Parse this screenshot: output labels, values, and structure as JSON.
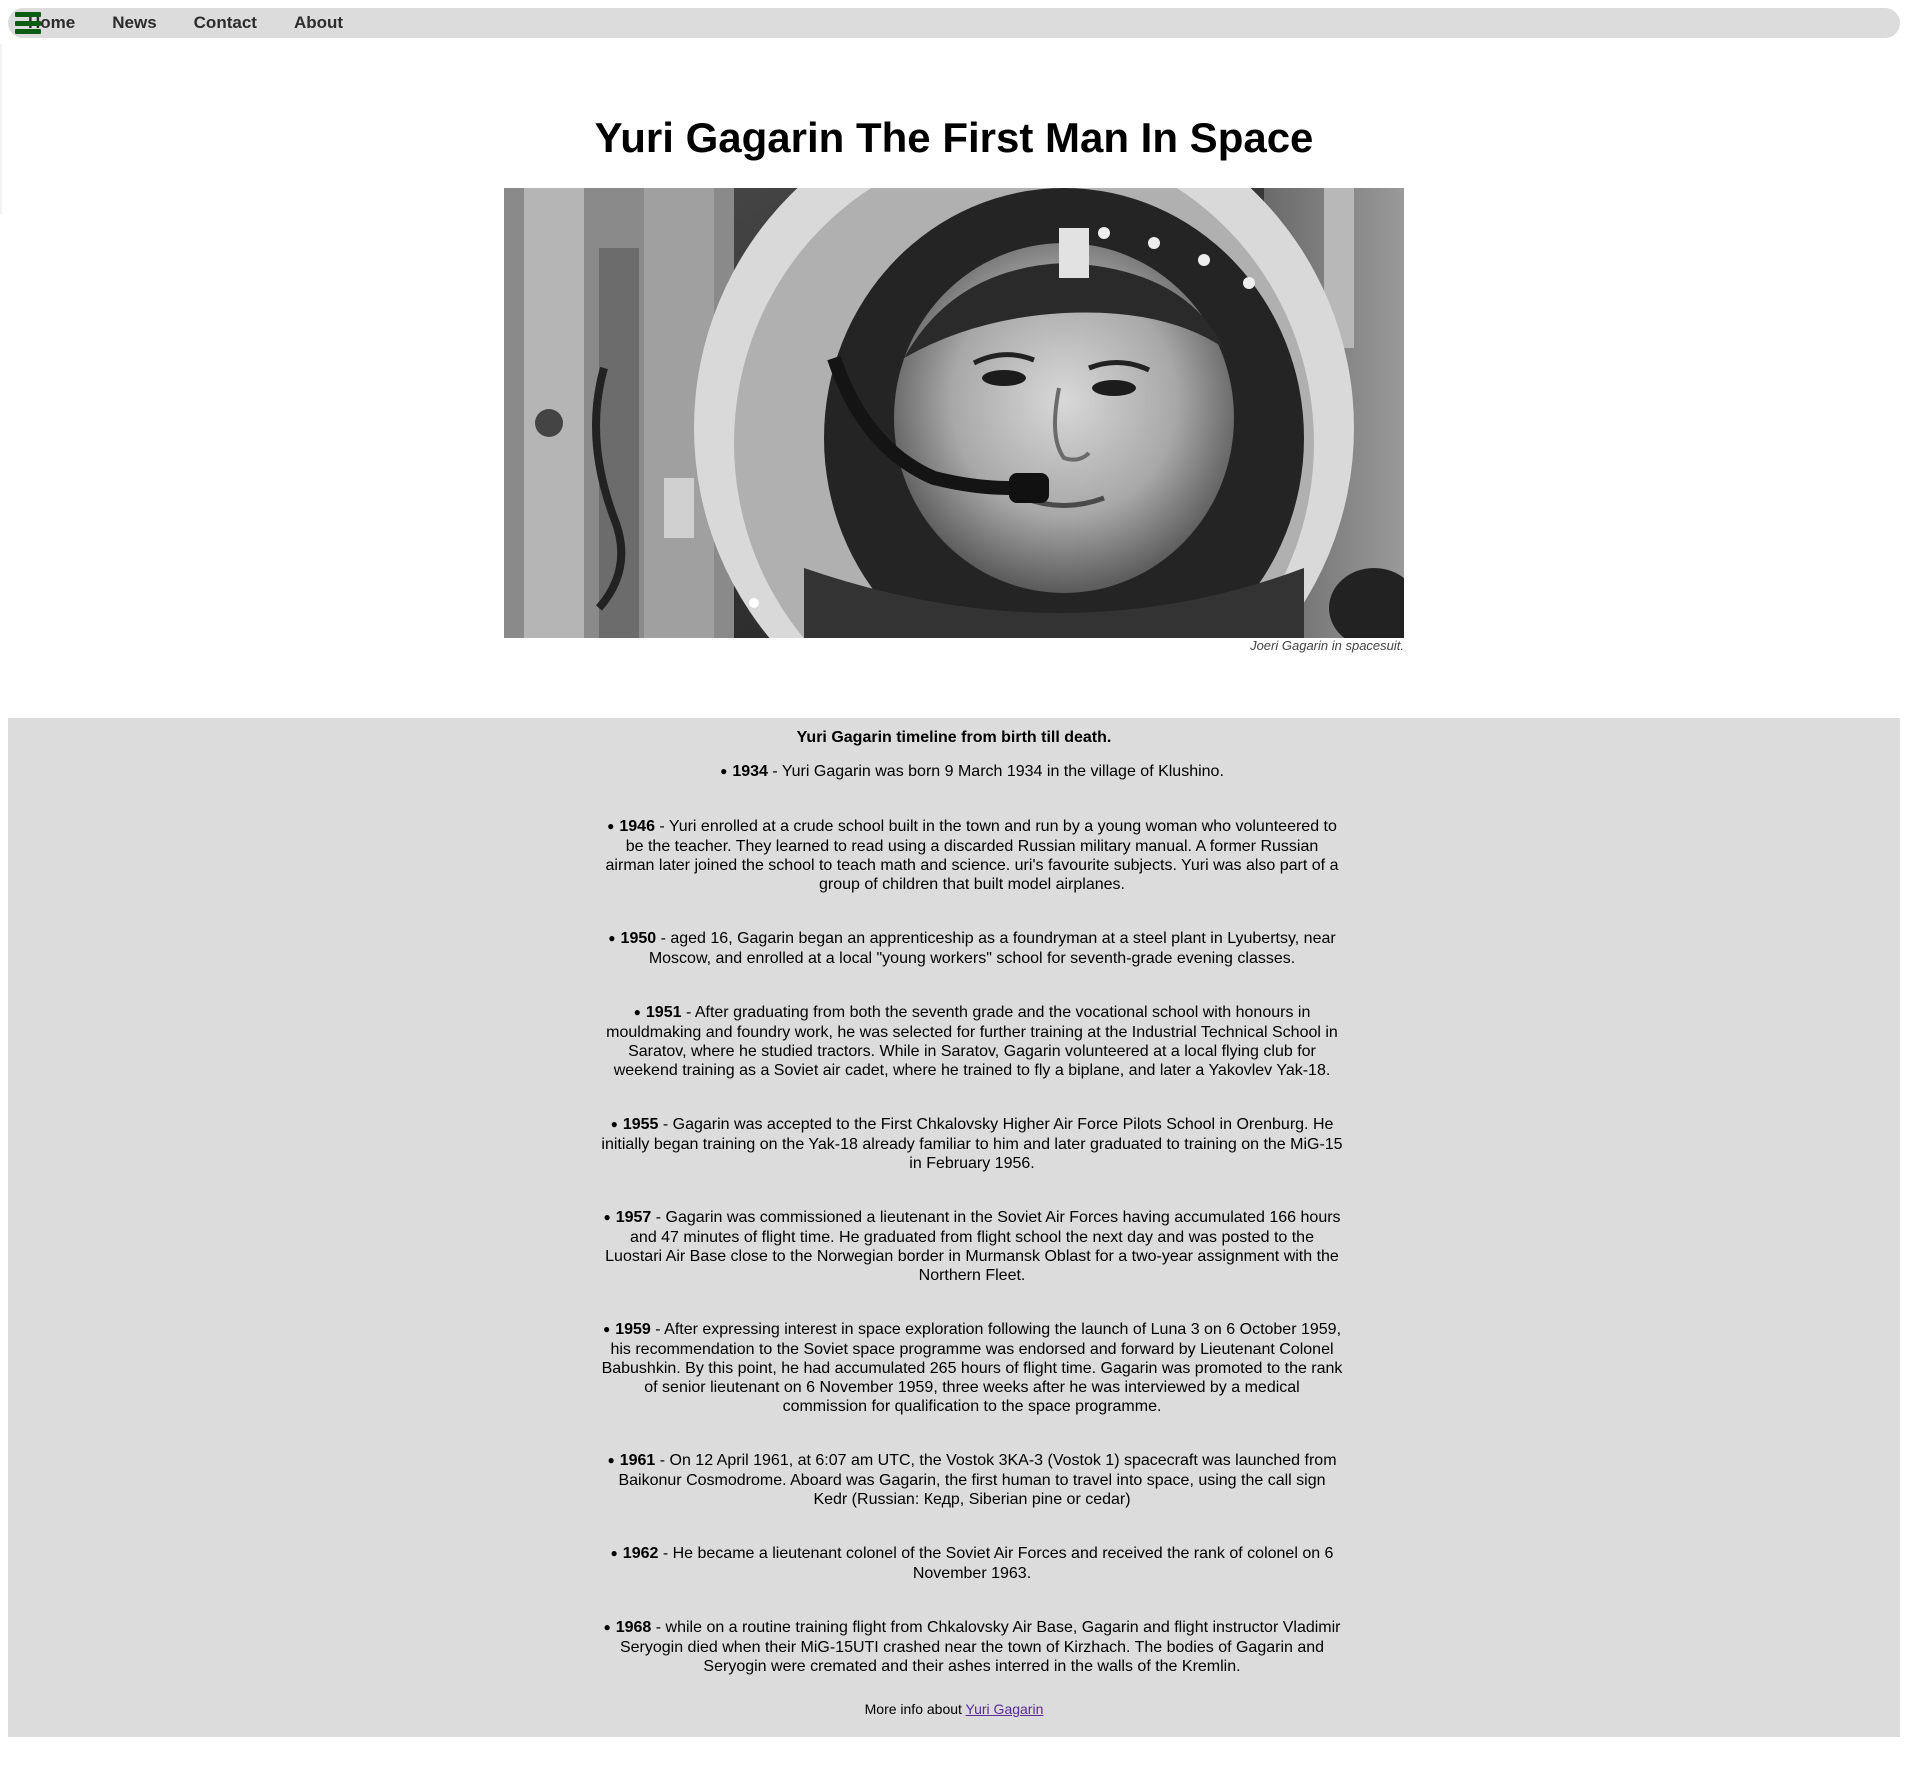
{
  "nav": {
    "items": [
      "Home",
      "News",
      "Contact",
      "About"
    ]
  },
  "page": {
    "title": "Yuri Gagarin The First Man In Space",
    "image_caption": "Joeri Gagarin in spacesuit."
  },
  "timeline": {
    "title": "Yuri Gagarin timeline from birth till death.",
    "events": [
      {
        "year": "1934",
        "text": " - Yuri Gagarin was born 9 March 1934 in the village of Klushino."
      },
      {
        "year": "1946",
        "text": " - Yuri enrolled at a crude school built in the town and run by a young woman who volunteered to be the teacher. They learned to read using a discarded Russian military manual. A former Russian airman later joined the school to teach math and science. uri's favourite subjects. Yuri was also part of a group of children that built model airplanes."
      },
      {
        "year": "1950",
        "text": " - aged 16, Gagarin began an apprenticeship as a foundryman at a steel plant in Lyubertsy, near Moscow, and enrolled at a local \"young workers\" school for seventh-grade evening classes."
      },
      {
        "year": "1951",
        "text": " - After graduating from both the seventh grade and the vocational school with honours in mouldmaking and foundry work, he was selected for further training at the Industrial Technical School in Saratov, where he studied tractors. While in Saratov, Gagarin volunteered at a local flying club for weekend training as a Soviet air cadet, where he trained to fly a biplane, and later a Yakovlev Yak-18."
      },
      {
        "year": "1955",
        "text": " - Gagarin was accepted to the First Chkalovsky Higher Air Force Pilots School in Orenburg. He initially began training on the Yak-18 already familiar to him and later graduated to training on the MiG-15 in February 1956."
      },
      {
        "year": "1957",
        "text": " - Gagarin was commissioned a lieutenant in the Soviet Air Forces having accumulated 166 hours and 47 minutes of flight time. He graduated from flight school the next day and was posted to the Luostari Air Base close to the Norwegian border in Murmansk Oblast for a two-year assignment with the Northern Fleet."
      },
      {
        "year": "1959",
        "text": " - After expressing interest in space exploration following the launch of Luna 3 on 6 October 1959, his recommendation to the Soviet space programme was endorsed and forward by Lieutenant Colonel Babushkin. By this point, he had accumulated 265 hours of flight time. Gagarin was promoted to the rank of senior lieutenant on 6 November 1959, three weeks after he was interviewed by a medical commission for qualification to the space programme."
      },
      {
        "year": "1961",
        "text": " - On 12 April 1961, at 6:07 am UTC, the Vostok 3KA-3 (Vostok 1) spacecraft was launched from Baikonur Cosmodrome. Aboard was Gagarin, the first human to travel into space, using the call sign Kedr (Russian: Кедр, Siberian pine or cedar)"
      },
      {
        "year": "1962",
        "text": " - He became a lieutenant colonel of the Soviet Air Forces and received the rank of colonel on 6 November 1963."
      },
      {
        "year": "1968",
        "text": " - while on a routine training flight from Chkalovsky Air Base, Gagarin and flight instructor Vladimir Seryogin died when their MiG-15UTI crashed near the town of Kirzhach. The bodies of Gagarin and Seryogin were cremated and their ashes interred in the walls of the Kremlin."
      }
    ],
    "more_info_prefix": "More info about ",
    "more_info_link": "Yuri Gagarin"
  },
  "colors": {
    "nav_background": "#dcdcdc",
    "menu_icon": "#0d5c14",
    "timeline_background": "#dcdcdc",
    "link": "#5a2a96"
  },
  "icons": {
    "menu": "hamburger-menu-icon"
  }
}
